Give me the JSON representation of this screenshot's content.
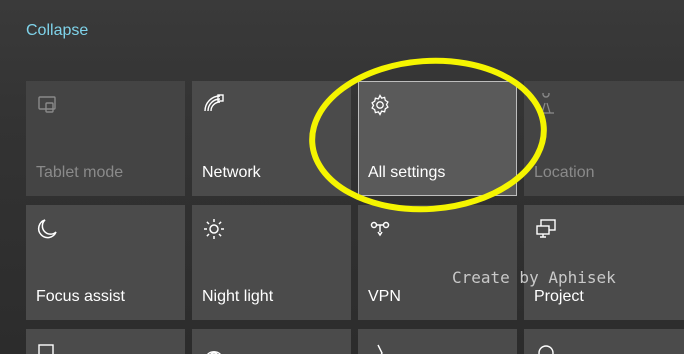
{
  "header": {
    "collapse_label": "Collapse"
  },
  "tiles": [
    {
      "label": "Tablet mode",
      "icon": "tablet-mode-icon",
      "state": "disabled"
    },
    {
      "label": "Network",
      "icon": "network-icon",
      "state": "normal"
    },
    {
      "label": "All settings",
      "icon": "gear-icon",
      "state": "selected"
    },
    {
      "label": "Location",
      "icon": "location-icon",
      "state": "disabled"
    },
    {
      "label": "Focus assist",
      "icon": "moon-icon",
      "state": "normal"
    },
    {
      "label": "Night light",
      "icon": "sun-icon",
      "state": "normal"
    },
    {
      "label": "VPN",
      "icon": "vpn-icon",
      "state": "normal"
    },
    {
      "label": "Project",
      "icon": "project-icon",
      "state": "normal"
    }
  ],
  "annotation": {
    "watermark": "Create by Aphisek",
    "highlight_color": "#f5f500"
  },
  "colors": {
    "accent": "#7fd3ea",
    "tile": "#4b4b4b",
    "tile_disabled": "#444444"
  }
}
